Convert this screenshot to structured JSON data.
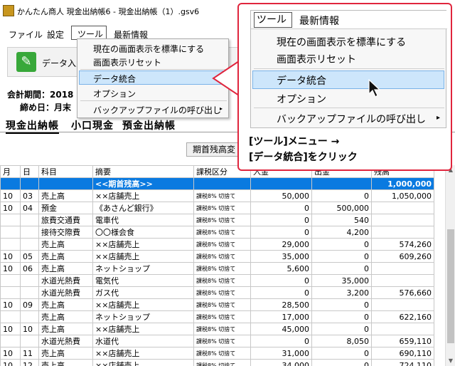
{
  "window": {
    "title": "かんたん商人 現金出納帳6 - 現金出納帳（1）.gsv6"
  },
  "menubar": {
    "file": "ファイル",
    "settings": "設定",
    "tools": "ツール",
    "news": "最新情報"
  },
  "toolbar": {
    "data_entry_label": "データ入力"
  },
  "info": {
    "period": "会計期間：2018",
    "closing": "締め日：月末"
  },
  "tabs": [
    "現金出納帳",
    "小口現金",
    "預金出納帳"
  ],
  "opening_balance_button": "期首残高変",
  "tools_menu": {
    "items": [
      {
        "label": "現在の画面表示を標準にする"
      },
      {
        "label": "画面表示リセット"
      },
      {
        "label": "データ統合"
      },
      {
        "label": "オプション"
      },
      {
        "label": "バックアップファイルの呼び出し",
        "submenu_icon": "▸"
      }
    ]
  },
  "callout": {
    "line1": "[ツール]メニュー →",
    "line2": "[データ統合]をクリック",
    "border_color": "#e0253d"
  },
  "table": {
    "headers": [
      "月",
      "日",
      "科目",
      "摘要",
      "課税区分",
      "入金",
      "出金",
      "残高"
    ],
    "rows": [
      [
        "",
        "",
        "",
        "<<期首残高>>",
        "",
        "",
        "",
        "1,000,000"
      ],
      [
        "10",
        "03",
        "売上高",
        "××店舗売上",
        "課税8% 切捨て",
        "50,000",
        "0",
        "1,050,000"
      ],
      [
        "10",
        "04",
        "預金",
        "《あさんど銀行》",
        "課税8% 切捨て",
        "0",
        "500,000",
        ""
      ],
      [
        "",
        "",
        "旅費交通費",
        "電車代",
        "課税8% 切捨て",
        "0",
        "540",
        ""
      ],
      [
        "",
        "",
        "接待交際費",
        "〇〇様会食",
        "課税8% 切捨て",
        "0",
        "4,200",
        ""
      ],
      [
        "",
        "",
        "売上高",
        "××店舗売上",
        "課税8% 切捨て",
        "29,000",
        "0",
        "574,260"
      ],
      [
        "10",
        "05",
        "売上高",
        "××店舗売上",
        "課税8% 切捨て",
        "35,000",
        "0",
        "609,260"
      ],
      [
        "10",
        "06",
        "売上高",
        "ネットショップ",
        "課税8% 切捨て",
        "5,600",
        "0",
        ""
      ],
      [
        "",
        "",
        "水道光熱費",
        "電気代",
        "課税8% 切捨て",
        "0",
        "35,000",
        ""
      ],
      [
        "",
        "",
        "水道光熱費",
        "ガス代",
        "課税8% 切捨て",
        "0",
        "3,200",
        "576,660"
      ],
      [
        "10",
        "09",
        "売上高",
        "××店舗売上",
        "課税8% 切捨て",
        "28,500",
        "0",
        ""
      ],
      [
        "",
        "",
        "売上高",
        "ネットショップ",
        "課税8% 切捨て",
        "17,000",
        "0",
        "622,160"
      ],
      [
        "10",
        "10",
        "売上高",
        "××店舗売上",
        "課税8% 切捨て",
        "45,000",
        "0",
        ""
      ],
      [
        "",
        "",
        "水道光熱費",
        "水道代",
        "課税8% 切捨て",
        "0",
        "8,050",
        "659,110"
      ],
      [
        "10",
        "11",
        "売上高",
        "××店舗売上",
        "課税8% 切捨て",
        "31,000",
        "0",
        "690,110"
      ],
      [
        "10",
        "12",
        "売上高",
        "××店舗売上",
        "課税8% 切捨て",
        "34,000",
        "0",
        "724,110"
      ]
    ]
  }
}
